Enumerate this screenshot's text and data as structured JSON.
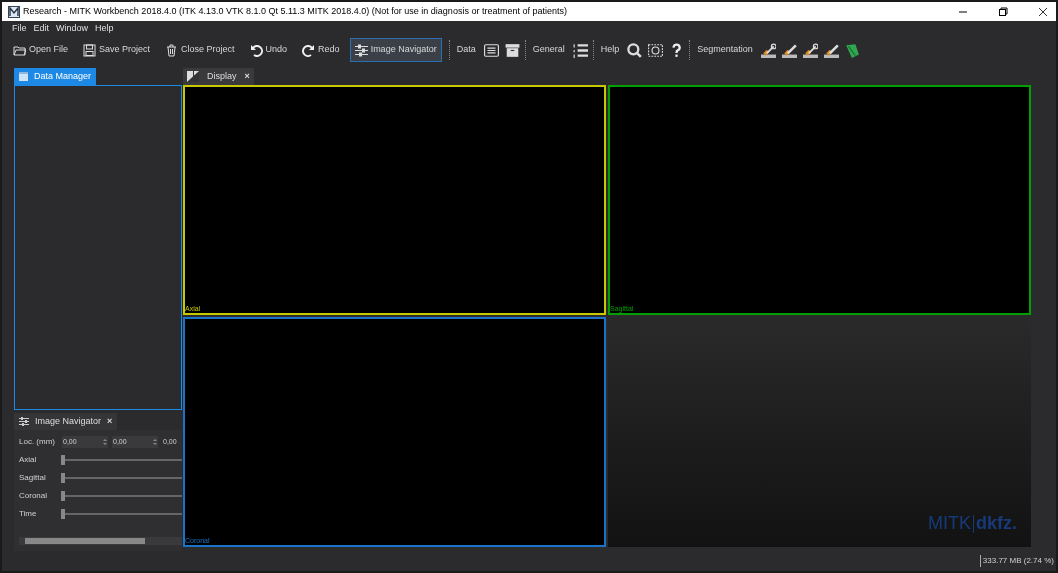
{
  "window": {
    "title": "Research - MITK Workbench 2018.4.0 (ITK 4.13.0  VTK 8.1.0 Qt 5.11.3 MITK 2018.4.0) (Not for use in diagnosis or treatment of patients)"
  },
  "menu": [
    "File",
    "Edit",
    "Window",
    "Help"
  ],
  "toolbar": [
    {
      "kind": "button",
      "label": "Open File",
      "selected": false
    },
    {
      "kind": "button",
      "label": "Save Project",
      "selected": false
    },
    {
      "kind": "button",
      "label": "Close Project",
      "selected": false
    },
    {
      "kind": "button",
      "label": "Undo",
      "selected": false
    },
    {
      "kind": "button",
      "label": "Redo",
      "selected": false
    },
    {
      "kind": "button",
      "label": "Image Navigator",
      "selected": true
    },
    {
      "kind": "separator"
    },
    {
      "kind": "label",
      "label": "Data"
    },
    {
      "kind": "icon"
    },
    {
      "kind": "icon"
    },
    {
      "kind": "separator"
    },
    {
      "kind": "label",
      "label": "General"
    },
    {
      "kind": "icon"
    },
    {
      "kind": "separator"
    },
    {
      "kind": "label",
      "label": "Help"
    },
    {
      "kind": "icon"
    },
    {
      "kind": "icon"
    },
    {
      "kind": "icon"
    },
    {
      "kind": "separator"
    },
    {
      "kind": "label",
      "label": "Segmentation"
    },
    {
      "kind": "icon"
    },
    {
      "kind": "icon"
    },
    {
      "kind": "icon"
    },
    {
      "kind": "icon"
    },
    {
      "kind": "icon"
    }
  ],
  "data_manager": {
    "tab": "Data Manager"
  },
  "display": {
    "tab": "Display",
    "close": "×"
  },
  "views": [
    {
      "kind": "slice",
      "label": "Axial",
      "color": "#c8c800"
    },
    {
      "kind": "slice",
      "label": "Sagittal",
      "color": "#00a000"
    },
    {
      "kind": "slice",
      "label": "Coronal",
      "color": "#1a73c8"
    },
    {
      "kind": "volume"
    }
  ],
  "logo": {
    "left": "MITK",
    "right": "dkfz."
  },
  "image_navigator": {
    "tab": "Image Navigator",
    "close": "×",
    "location_label": "Loc. (mm)",
    "location_values": [
      "0,00",
      "0,00",
      "0,00"
    ],
    "sliders": [
      {
        "label": "Axial",
        "level": 0
      },
      {
        "label": "Sagittal",
        "level": 0
      },
      {
        "label": "Coronal",
        "level": 0
      },
      {
        "label": "Time",
        "level": 0
      }
    ]
  },
  "status_bar": {
    "memory": "333.77 MB (2.74 %)"
  }
}
